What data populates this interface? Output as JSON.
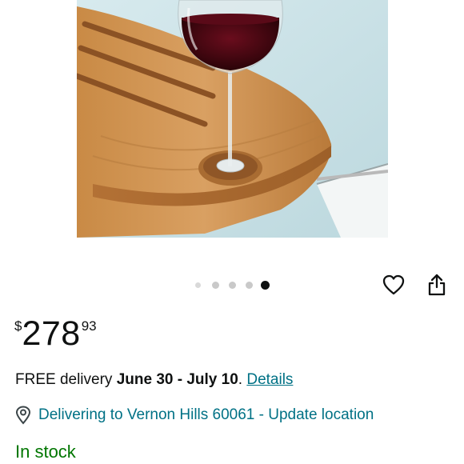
{
  "price": {
    "symbol": "$",
    "whole": "278",
    "fraction": "93"
  },
  "carousel": {
    "total": 5,
    "active_index": 4
  },
  "icons": {
    "wishlist": "heart-icon",
    "share": "share-icon",
    "location": "location-pin-icon"
  },
  "delivery": {
    "prefix": "FREE delivery",
    "dates": "June 30 - July 10",
    "separator": ".",
    "details_link": "Details"
  },
  "location": {
    "text": "Delivering to Vernon Hills 60061 - Update location"
  },
  "stock": {
    "status": "In stock"
  },
  "colors": {
    "link": "#007185",
    "in_stock": "#007600",
    "text": "#0f1111"
  }
}
